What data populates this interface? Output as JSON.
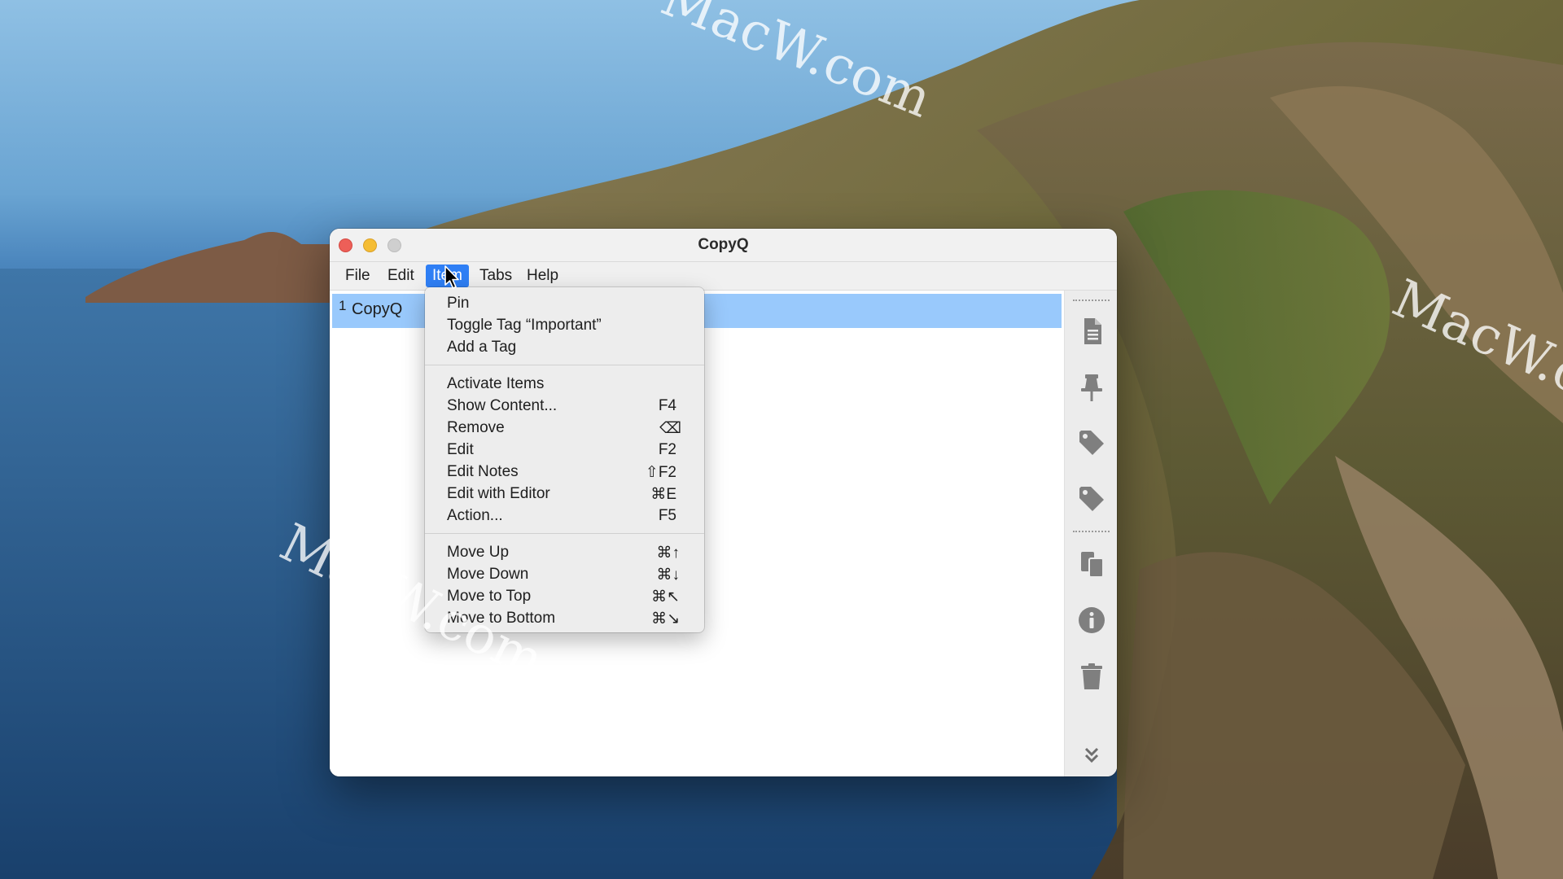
{
  "window": {
    "title": "CopyQ"
  },
  "menubar": {
    "items": [
      {
        "label": "File"
      },
      {
        "label": "Edit"
      },
      {
        "label": "Item"
      },
      {
        "label": "Tabs"
      },
      {
        "label": "Help"
      }
    ],
    "active": "Item"
  },
  "list": {
    "rows": [
      {
        "number": "1",
        "text": "CopyQ",
        "selected": true
      }
    ]
  },
  "item_menu": {
    "groups": [
      [
        {
          "label": "Pin",
          "shortcut": ""
        },
        {
          "label": "Toggle Tag “Important”",
          "shortcut": ""
        },
        {
          "label": "Add a Tag",
          "shortcut": ""
        }
      ],
      [
        {
          "label": "Activate Items",
          "shortcut": ""
        },
        {
          "label": "Show Content...",
          "shortcut": "F4"
        },
        {
          "label": "Remove",
          "shortcut": "⌫"
        },
        {
          "label": "Edit",
          "shortcut": "F2"
        },
        {
          "label": "Edit Notes",
          "shortcut": "⇧F2"
        },
        {
          "label": "Edit with Editor",
          "shortcut": "⌘E"
        },
        {
          "label": "Action...",
          "shortcut": "F5"
        }
      ],
      [
        {
          "label": "Move Up",
          "shortcut": "⌘↑"
        },
        {
          "label": "Move Down",
          "shortcut": "⌘↓"
        },
        {
          "label": "Move to Top",
          "shortcut": "⌘↖"
        },
        {
          "label": "Move to Bottom",
          "shortcut": "⌘↘"
        }
      ]
    ]
  },
  "toolbar": {
    "icons": [
      "document-icon",
      "pin-icon",
      "tag-icon",
      "tag-icon",
      "paste-icon",
      "info-icon",
      "trash-icon",
      "chevron-double-down-icon"
    ]
  },
  "watermark": {
    "text": "MacW.com"
  },
  "colors": {
    "menu_highlight": "#2f7ff5",
    "selected_row": "#99c9fc",
    "close": "#ed5f58",
    "minimize": "#f5bd34",
    "zoom_disabled": "#cfcfcf"
  }
}
